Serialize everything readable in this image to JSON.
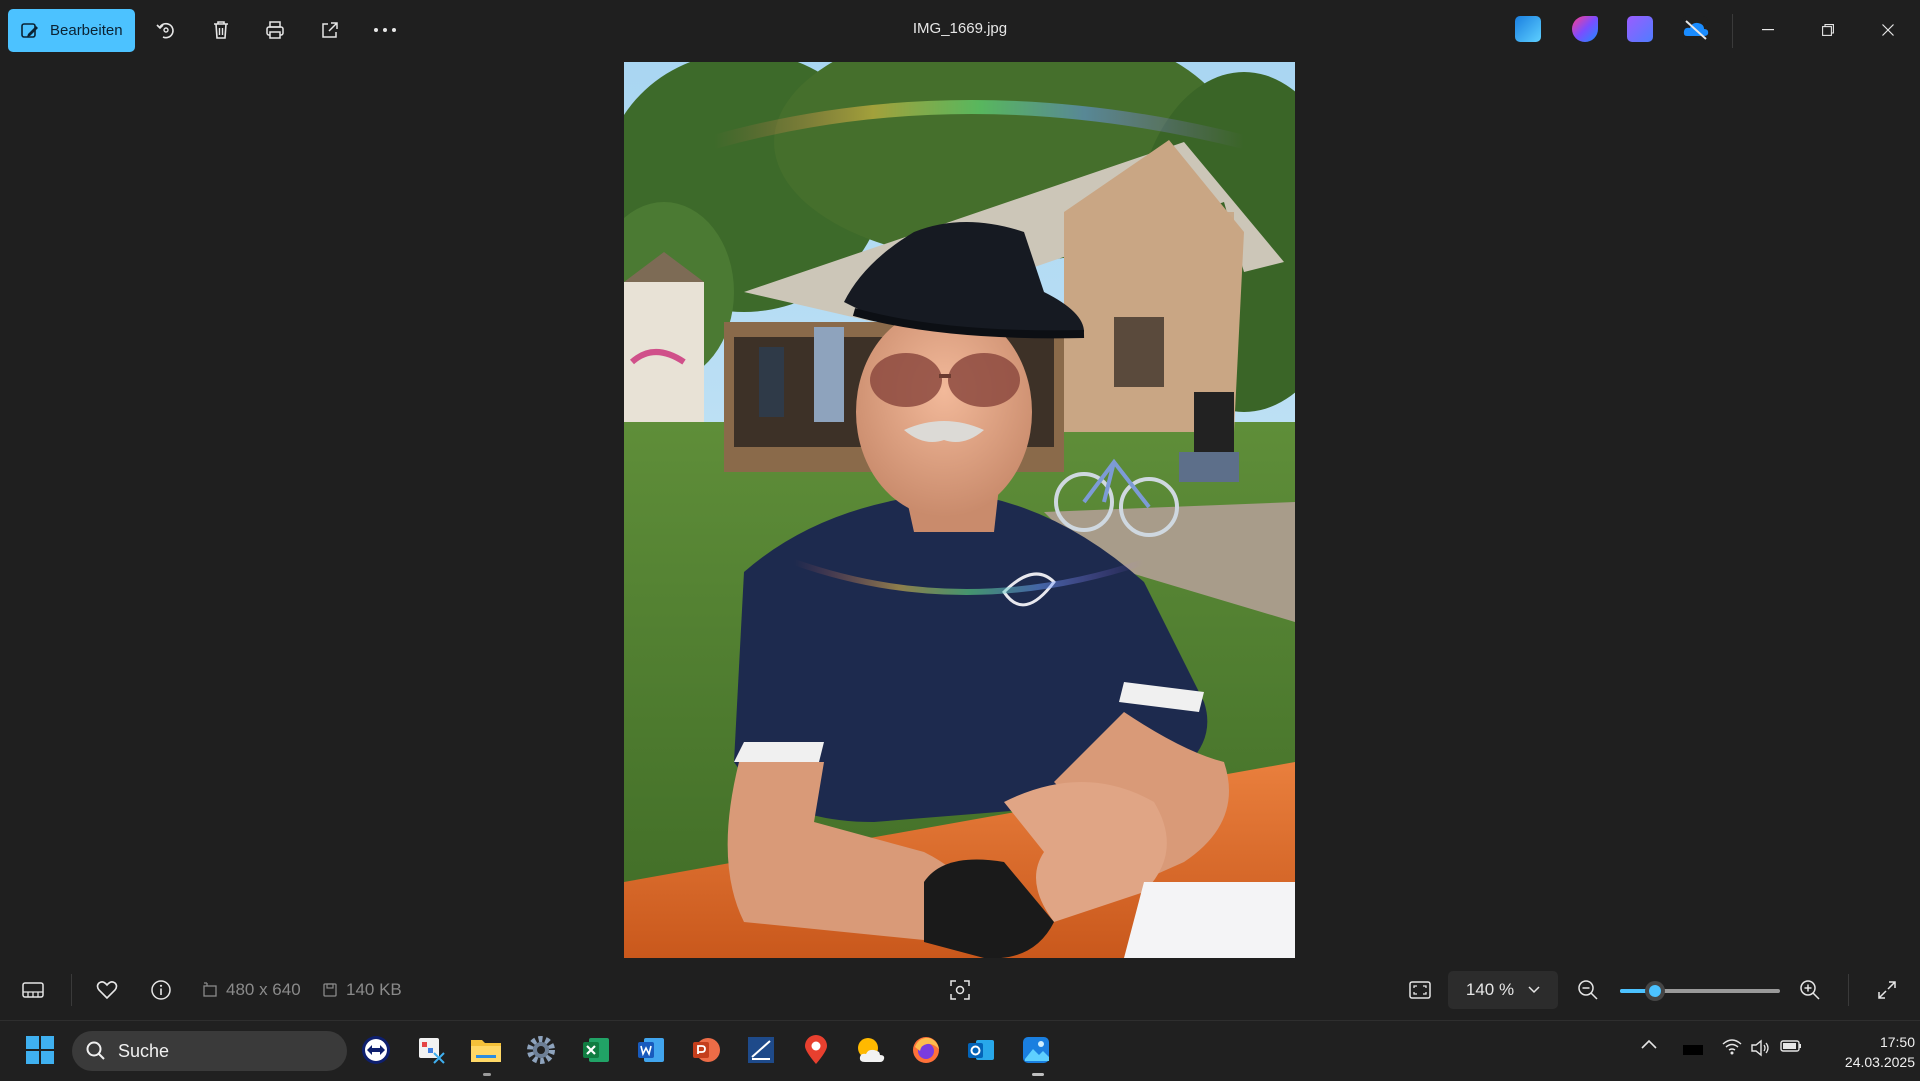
{
  "toolbar": {
    "edit_label": "Bearbeiten",
    "file_title": "IMG_1669.jpg",
    "accent": "#4cc2ff"
  },
  "photo": {
    "description_icons": [
      "image"
    ]
  },
  "bottombar": {
    "dimensions": "480 x 640",
    "file_size": "140 KB",
    "zoom_label": "140 %",
    "zoom_level_fraction": 0.22
  },
  "taskbar": {
    "search_placeholder": "Suche",
    "time": "17:50",
    "date": "24.03.2025"
  }
}
